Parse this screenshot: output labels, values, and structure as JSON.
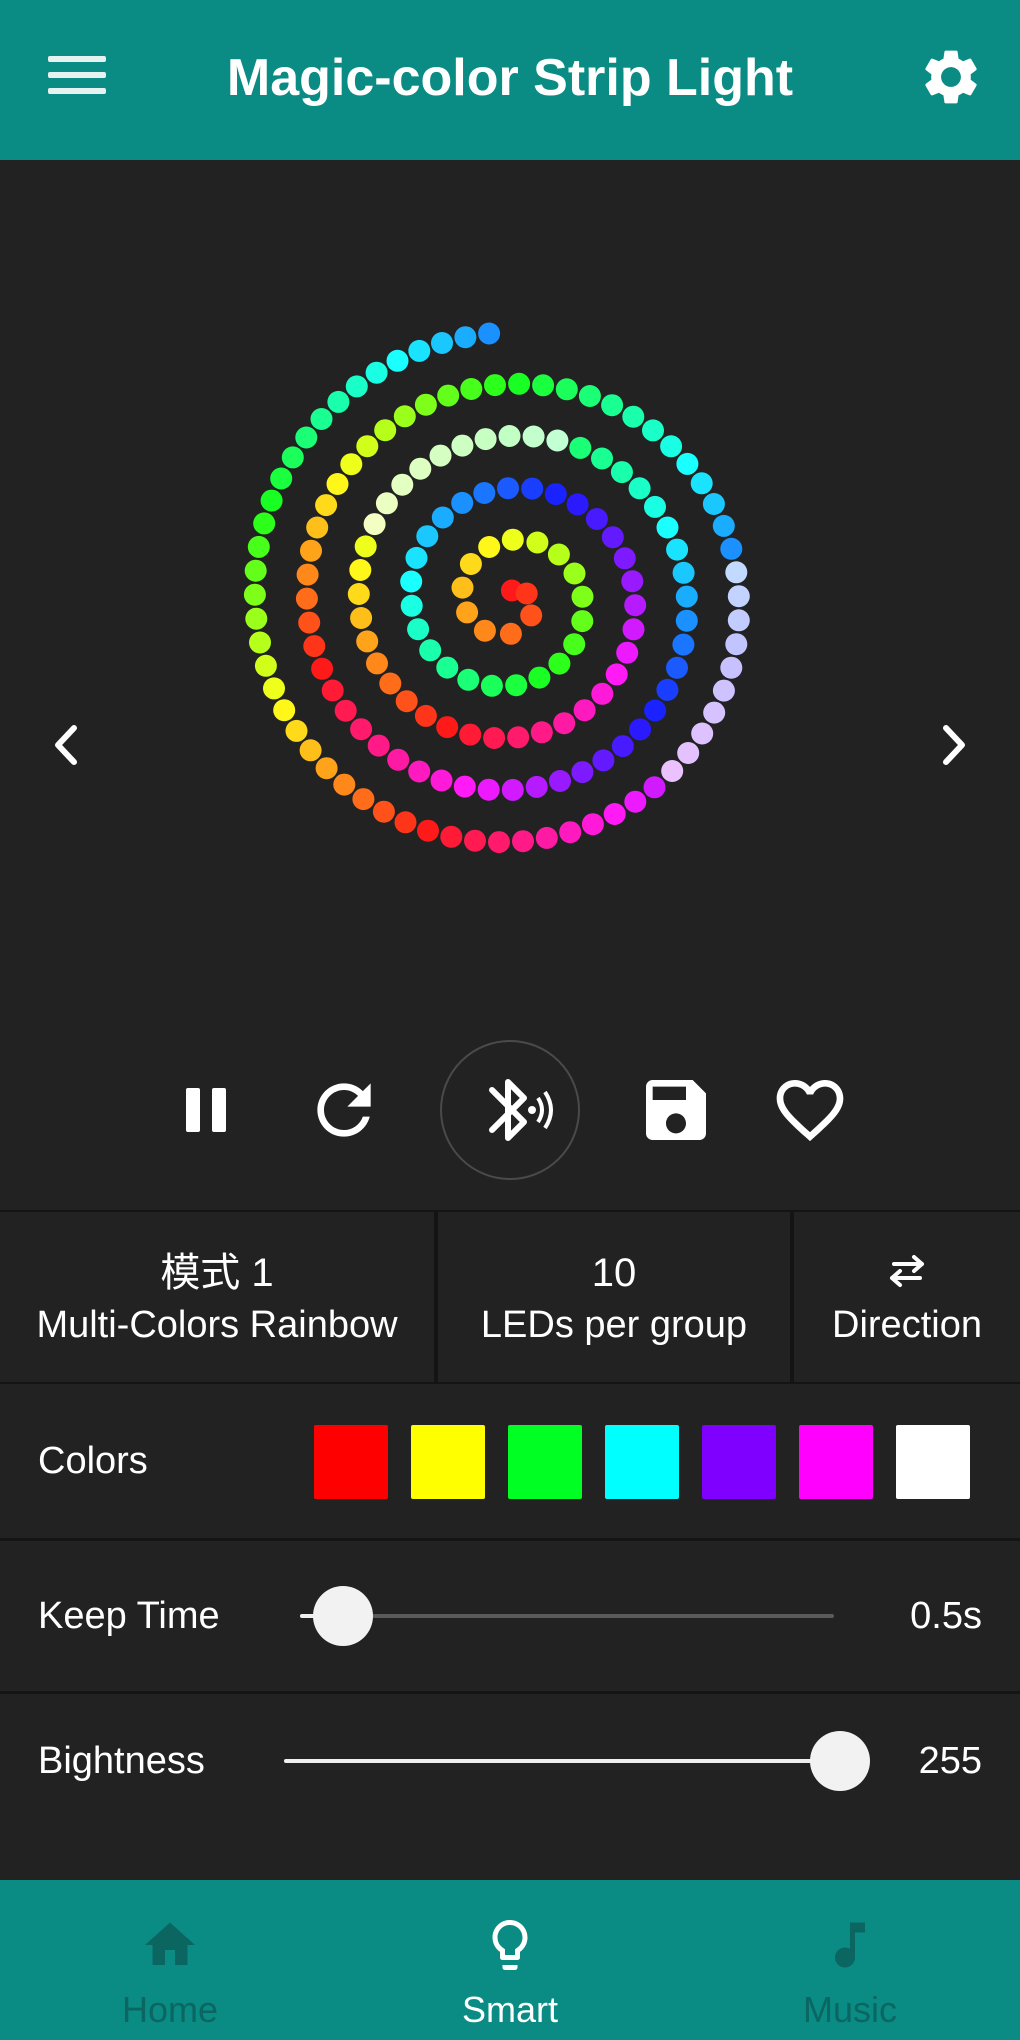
{
  "header": {
    "title": "Magic-color Strip Light",
    "menu_icon": "hamburger-menu-icon",
    "settings_icon": "gear-icon"
  },
  "preview": {
    "prev_icon": "chevron-left-icon",
    "next_icon": "chevron-right-icon"
  },
  "controls": {
    "icons": [
      "pause-icon",
      "refresh-icon",
      "bluetooth-audio-icon",
      "save-icon",
      "heart-icon"
    ]
  },
  "mode": {
    "mode_label": "模式 1",
    "mode_name": "Multi-Colors Rainbow",
    "leds_value": "10",
    "leds_label": "LEDs per group",
    "direction_label": "Direction",
    "direction_icon": "swap-arrows-icon"
  },
  "colors": {
    "label": "Colors",
    "swatches": [
      "#ff0000",
      "#ffff00",
      "#00ff22",
      "#00ffff",
      "#7f00ff",
      "#ff00ff",
      "#ffffff"
    ]
  },
  "keep_time": {
    "label": "Keep Time",
    "value": "0.5s",
    "level": 0.08
  },
  "brightness": {
    "label": "Bightness",
    "value": "255",
    "level": 1.0
  },
  "bottom_nav": {
    "items": [
      {
        "label": "Home",
        "icon": "home-icon",
        "active": false
      },
      {
        "label": "Smart",
        "icon": "lightbulb-icon",
        "active": true
      },
      {
        "label": "Music",
        "icon": "music-note-icon",
        "active": false
      }
    ]
  },
  "theme": {
    "accent": "#0a8c85",
    "background": "#222222"
  }
}
